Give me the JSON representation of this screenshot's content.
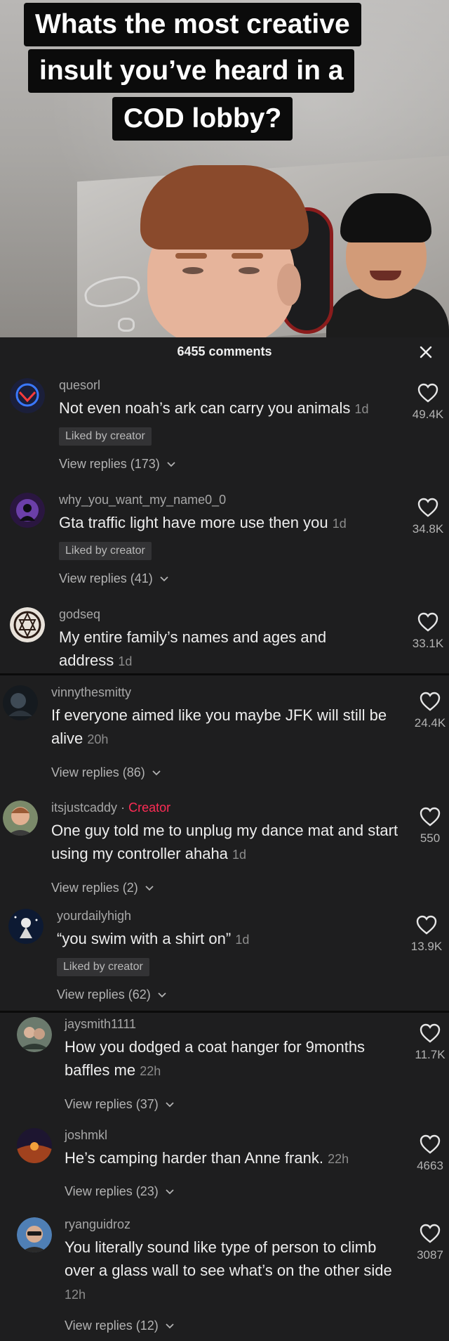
{
  "video": {
    "caption_lines": [
      "Whats the most creative",
      "insult you’ve heard in a",
      "COD lobby?"
    ]
  },
  "panel": {
    "comments_count": "6455 comments",
    "close_icon": "close-icon"
  },
  "comments": [
    {
      "username": "quesorl",
      "text": "Not even noah’s ark can carry you animals",
      "time": "1d",
      "liked_by_creator": "Liked by creator",
      "replies": "View replies (173)",
      "likes": "49.4K"
    },
    {
      "username": "why_you_want_my_name0_0",
      "text": "Gta traffic light have more use then you",
      "time": "1d",
      "liked_by_creator": "Liked by creator",
      "replies": "View replies (41)",
      "likes": "34.8K"
    },
    {
      "username": "godseq",
      "text": "My entire family’s names and ages and address",
      "time": "1d",
      "likes": "33.1K"
    },
    {
      "username": "vinnythesmitty",
      "text": "If everyone aimed like you maybe JFK will still be alive",
      "time": "20h",
      "replies": "View replies (86)",
      "likes": "24.4K"
    },
    {
      "username": "itsjustcaddy",
      "creator_sep": "·",
      "creator_label": "Creator",
      "text": "One guy told me to unplug my dance mat and start using my controller ahaha",
      "time": "1d",
      "replies": "View replies (2)",
      "likes": "550"
    },
    {
      "username": "yourdailyhigh",
      "text": "“you swim with a shirt on”",
      "time": "1d",
      "liked_by_creator": "Liked by creator",
      "replies": "View replies (62)",
      "likes": "13.9K"
    },
    {
      "username": "jaysmith1111",
      "text": "How you dodged a coat hanger for 9months baffles me",
      "time": "22h",
      "replies": "View replies (37)",
      "likes": "11.7K"
    },
    {
      "username": "joshmkl",
      "text": "He’s camping harder than Anne frank.",
      "time": "22h",
      "replies": "View replies (23)",
      "likes": "4663"
    },
    {
      "username": "ryanguidroz",
      "text": "You literally sound like type of person to climb over a glass wall to see what’s on the other side",
      "time": "12h",
      "replies": "View replies (12)",
      "likes": "3087"
    }
  ],
  "colors": {
    "background": "#1e1e1f",
    "creator": "#fe2c55",
    "muted": "#a7a7a7"
  }
}
